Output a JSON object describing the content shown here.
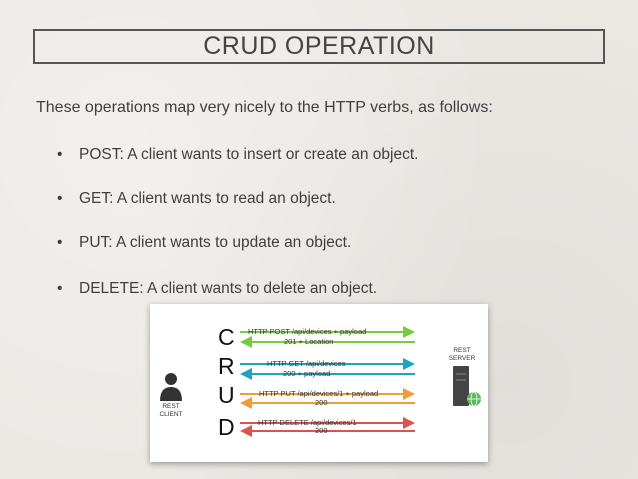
{
  "slide": {
    "title": "CRUD OPERATION",
    "intro": "These operations map very nicely to the HTTP verbs, as follows:",
    "bullets": [
      "POST: A client wants to insert or create an object.",
      "GET: A client wants to read an object.",
      "PUT: A client wants to update an object.",
      "DELETE: A client wants to delete an object."
    ],
    "bullet_char": "•"
  },
  "diagram": {
    "client_label_1": "REST",
    "client_label_2": "CLIENT",
    "server_label_1": "REST",
    "server_label_2": "SERVER",
    "crud_letters": [
      "C",
      "R",
      "U",
      "D"
    ],
    "rows": [
      {
        "request": "HTTP POST /api/devices + payload",
        "response": "201 + Location",
        "color": "#7ac943"
      },
      {
        "request": "HTTP GET /api/devices",
        "response": "200 + payload",
        "color": "#1ea3c5"
      },
      {
        "request": "HTTP PUT /api/devices/1 + payload",
        "response": "200",
        "color": "#f09b3c"
      },
      {
        "request": "HTTP DELETE /api/devices/1",
        "response": "200",
        "color": "#d9534f"
      }
    ]
  }
}
